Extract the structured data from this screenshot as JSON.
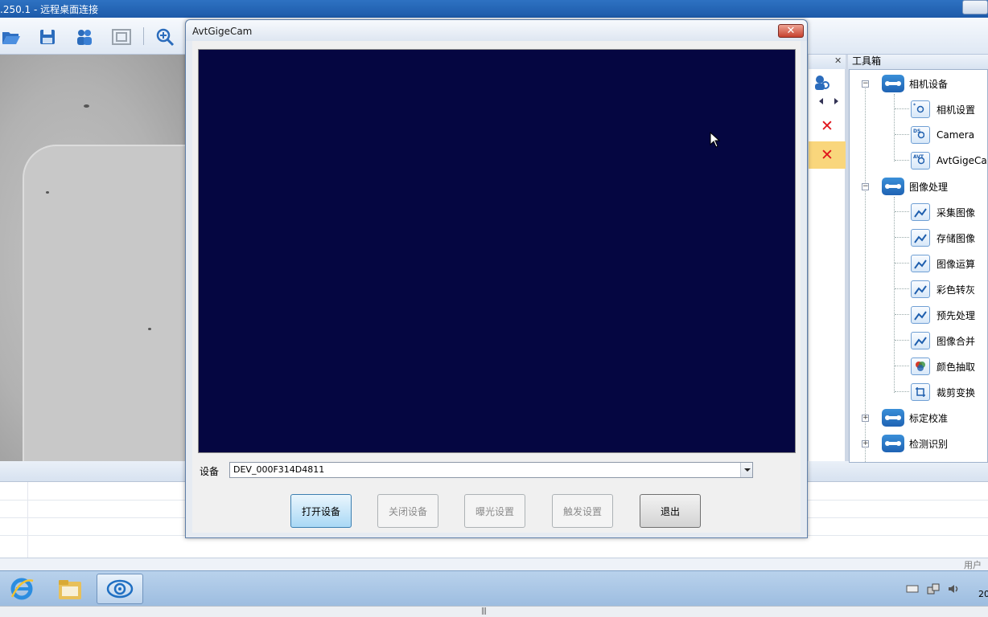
{
  "remote_desktop": {
    "title": ".250.1 - 远程桌面连接"
  },
  "toolbar": {
    "buttons": [
      "folder-open-icon",
      "save-icon",
      "users-icon",
      "fit-window-icon",
      "zoom-in-icon"
    ]
  },
  "dialog": {
    "title": "AvtGigeCam",
    "close_label": "✕",
    "device_label": "设备",
    "device_value": "DEV_000F314D4811",
    "buttons": {
      "open_device": "打开设备",
      "close_device": "关闭设备",
      "exposure_settings": "曝光设置",
      "trigger_settings": "触发设置",
      "exit": "退出"
    },
    "button_states": {
      "open_device": "enabled",
      "close_device": "disabled",
      "exposure_settings": "disabled",
      "trigger_settings": "disabled",
      "exit": "enabled"
    }
  },
  "side_panel": {
    "close_label": "✕",
    "remove_label": "✕"
  },
  "toolbox": {
    "title": "工具箱",
    "groups": [
      {
        "label": "相机设备",
        "expanded": true,
        "items": [
          "相机设置",
          "Camera",
          "AvtGigeCam"
        ]
      },
      {
        "label": "图像处理",
        "expanded": true,
        "items": [
          "采集图像",
          "存储图像",
          "图像运算",
          "彩色转灰",
          "预先处理",
          "图像合并",
          "颜色抽取",
          "裁剪变换"
        ]
      },
      {
        "label": "标定校准",
        "expanded": false,
        "items": []
      },
      {
        "label": "检测识别",
        "expanded": false,
        "items": []
      }
    ]
  },
  "status": {
    "user_label": "用户"
  },
  "taskbar": {
    "apps": [
      "internet-explorer-icon",
      "file-explorer-icon",
      "vision-app-icon"
    ],
    "time_fragment": "20"
  },
  "colors": {
    "camera_background": "#050641",
    "accent_blue": "#1f63b4",
    "delete_red": "#e0141b",
    "selected_row": "#f9d67c"
  }
}
